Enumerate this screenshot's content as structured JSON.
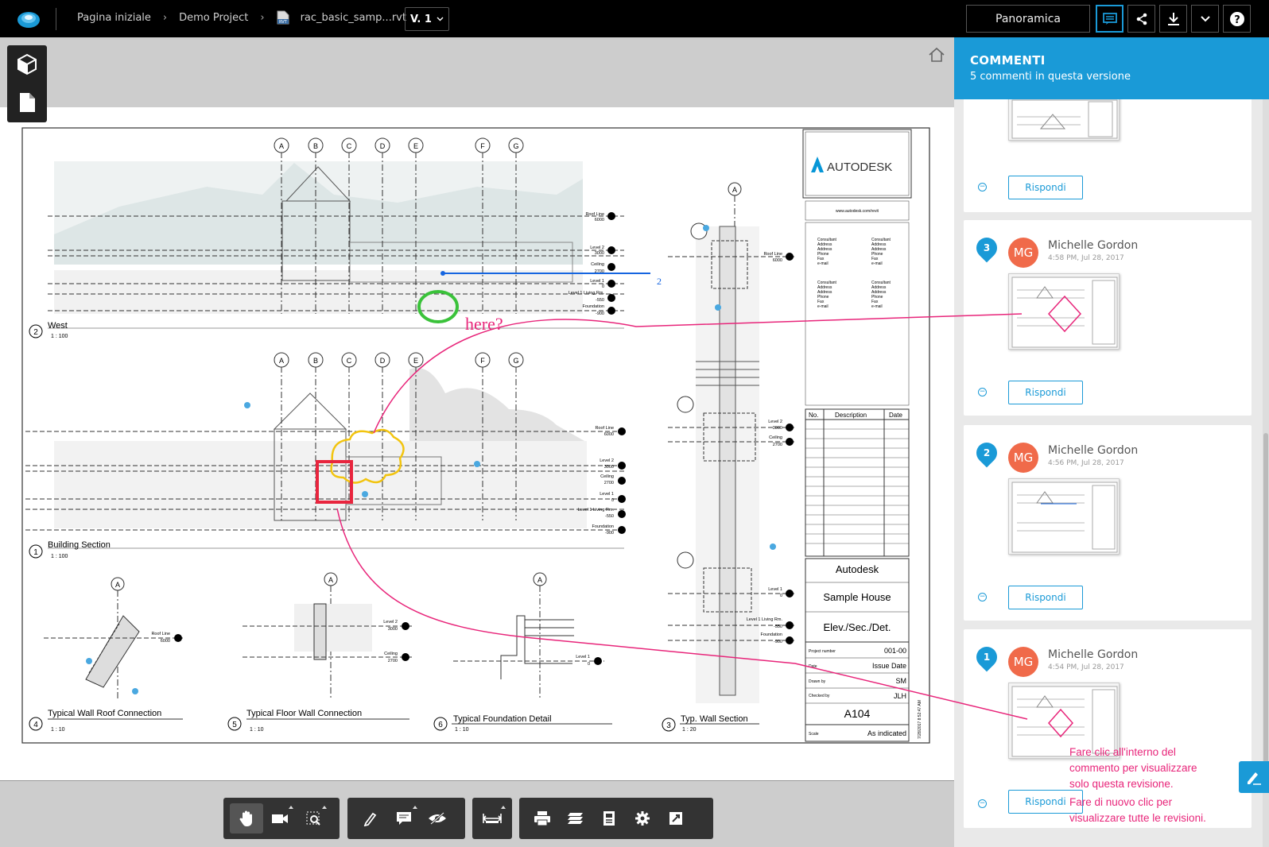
{
  "topbar": {
    "crumbs": [
      "Pagina iniziale",
      "Demo Project",
      "rac_basic_samp...rvt"
    ],
    "version": "V. 1",
    "view_mode": "Panoramica",
    "icons": [
      "comments-icon",
      "share-icon",
      "download-icon",
      "chevron-down-icon",
      "help-icon"
    ]
  },
  "sheet": {
    "brand": "AUTODESK",
    "url": "www.autodesk.com/revit",
    "views": [
      {
        "num": "2",
        "name": "West",
        "scale": "1 : 100"
      },
      {
        "num": "1",
        "name": "Building Section",
        "scale": "1 : 100"
      },
      {
        "num": "4",
        "name": "Typical Wall Roof Connection",
        "scale": "1 : 10"
      },
      {
        "num": "5",
        "name": "Typical Floor Wall Connection",
        "scale": "1 : 10"
      },
      {
        "num": "6",
        "name": "Typical Foundation Detail",
        "scale": "1 : 10"
      },
      {
        "num": "3",
        "name": "Typ. Wall Section",
        "scale": "1 : 20"
      }
    ],
    "grid_labels": [
      "A",
      "B",
      "C",
      "D",
      "E",
      "F",
      "G"
    ],
    "levels_west": [
      "Roof Line",
      "6000",
      "Level 2",
      "3000",
      "Ceiling",
      "2700",
      "Level 1",
      "0",
      "Level 1 Living Rm.",
      "-550",
      "Foundation",
      "-900"
    ],
    "levels_section": [
      "Roof Line",
      "6000",
      "Level 2",
      "3000",
      "Ceiling",
      "2700",
      "Level 1",
      "0",
      "Level 1 Living Rm.",
      "-550",
      "Foundation",
      "-900"
    ],
    "annotation_here": "here?",
    "annotation_number": "2",
    "consultant": [
      "Consultant",
      "Address",
      "Address",
      "Phone",
      "Fax",
      "e-mail"
    ],
    "rev_headers": [
      "No.",
      "Description",
      "Date"
    ],
    "title_block": {
      "company": "Autodesk",
      "project": "Sample House",
      "sheet_name": "Elev./Sec./Det.",
      "project_number_label": "Project number",
      "project_number": "001-00",
      "date_label": "Date",
      "date": "Issue Date",
      "drawn_label": "Drawn by",
      "drawn": "SM",
      "checked_label": "Checked by",
      "checked": "JLH",
      "sheet_number": "A104",
      "scale_label": "Scale",
      "scale": "As indicated",
      "stamp": "7/28/2017 8:52:47 AM"
    },
    "detail_levels": {
      "roof": [
        "Roof Line",
        "6000"
      ],
      "floor": [
        "Level 2",
        "3000",
        "Ceiling",
        "2700"
      ],
      "foundation": [
        "Level 1",
        "0"
      ],
      "wall_section": [
        "Roof Line",
        "6000",
        "Level 2",
        "3000",
        "Ceiling",
        "2700",
        "Level 1",
        "0",
        "Level 1 Living Rm.",
        "-550",
        "Foundation",
        "-900"
      ]
    }
  },
  "bottom_toolbar": {
    "groups": [
      [
        "pan-icon",
        "camera-icon",
        "fit-icon"
      ],
      [
        "markup-pen-icon",
        "comment-icon",
        "visibility-icon"
      ],
      [
        "measure-icon"
      ],
      [
        "print-icon",
        "layers-icon",
        "properties-icon",
        "settings-icon",
        "fullscreen-icon"
      ]
    ]
  },
  "comments": {
    "title": "COMMENTI",
    "subtitle": "5 commenti in questa versione",
    "reply_label": "Rispondi",
    "items": [
      {
        "num": "3",
        "initials": "MG",
        "author": "Michelle Gordon",
        "time": "4:58 PM, Jul 28, 2017"
      },
      {
        "num": "2",
        "initials": "MG",
        "author": "Michelle Gordon",
        "time": "4:56 PM, Jul 28, 2017"
      },
      {
        "num": "1",
        "initials": "MG",
        "author": "Michelle Gordon",
        "time": "4:54 PM, Jul 28, 2017"
      }
    ]
  },
  "callout": {
    "line1": "Fare clic all'interno del",
    "line2": "commento per visualizzare",
    "line3": "solo questa revisione.",
    "line4": "Fare di nuovo clic per",
    "line5": "visualizzare tutte le revisioni."
  },
  "colors": {
    "accent": "#1a9ad7",
    "callout": "#e8257a",
    "avatar": "#f06a4a",
    "markup_green": "#3ac23a",
    "markup_yellow": "#f2c40f",
    "markup_red": "#e8253e",
    "markup_blue": "#1565e0"
  }
}
